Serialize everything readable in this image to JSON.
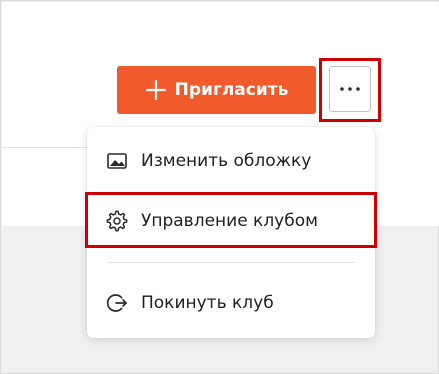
{
  "header": {
    "invite_button": {
      "label": "Пригласить",
      "icon": "plus-icon",
      "color": "#f15a2b"
    },
    "more_button": {
      "icon": "more-horizontal-icon"
    }
  },
  "dropdown": {
    "items": [
      {
        "label": "Изменить обложку",
        "icon": "image-icon"
      },
      {
        "label": "Управление клубом",
        "icon": "gear-icon"
      },
      {
        "label": "Покинуть клуб",
        "icon": "exit-icon"
      }
    ]
  },
  "colors": {
    "accent": "#f15a2b",
    "highlight_border": "#cc0000",
    "background": "#f0f0f0"
  }
}
